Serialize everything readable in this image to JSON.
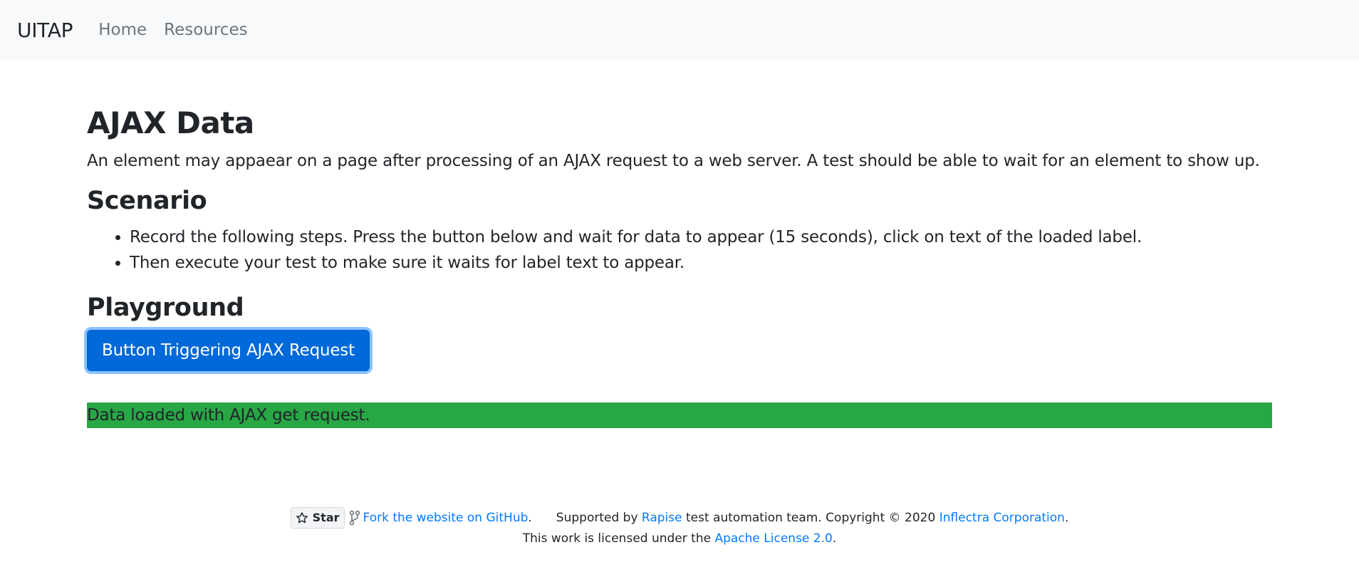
{
  "navbar": {
    "brand": "UITAP",
    "links": [
      "Home",
      "Resources"
    ]
  },
  "page": {
    "title": "AJAX Data",
    "lead": "An element may appaear on a page after processing of an AJAX request to a web server. A test should be able to wait for an element to show up.",
    "scenario_title": "Scenario",
    "steps": [
      "Record the following steps. Press the button below and wait for data to appear (15 seconds), click on text of the loaded label.",
      "Then execute your test to make sure it waits for label text to appear."
    ],
    "playground_title": "Playground",
    "button_label": "Button Triggering AJAX Request",
    "loaded_label": "Data loaded with AJAX get request."
  },
  "footer": {
    "star_label": "Star",
    "fork_link": "Fork the website on GitHub",
    "period": ".",
    "supported_by": "Supported by",
    "rapise_link": "Rapise",
    "team_text": "test automation team. Copyright © 2020",
    "inflectra_link": "Inflectra Corporation",
    "license_text": "This work is licensed under the",
    "license_link": "Apache License 2.0"
  },
  "colors": {
    "navbar_bg": "#f8f9fa",
    "primary": "#0069d9",
    "success": "#28a745",
    "link": "#007bff"
  }
}
